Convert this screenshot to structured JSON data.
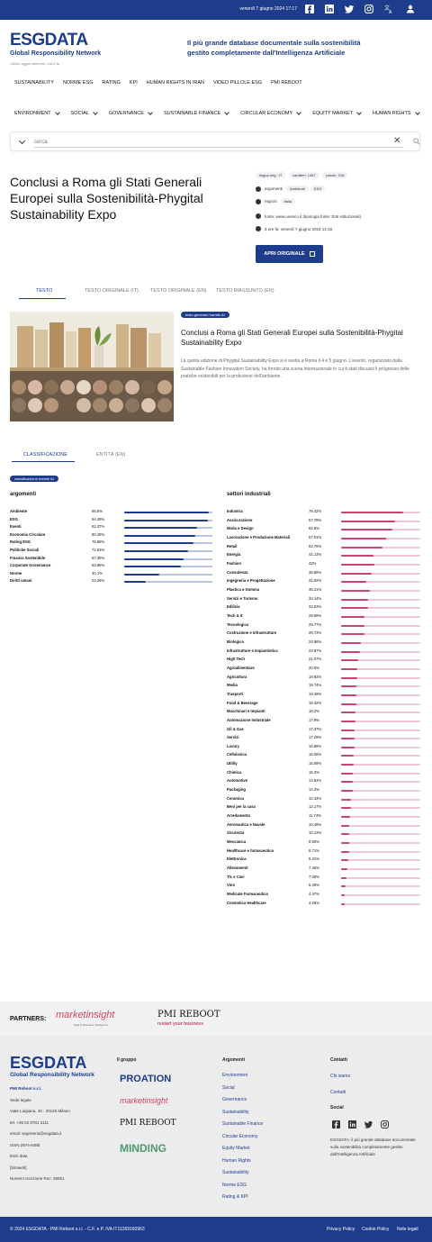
{
  "topbar": {
    "date": "venerdì 7 giugno 2024 17:17",
    "bg": "#1d3c8c"
  },
  "brand": {
    "logo": "ESGDATA",
    "logo_sub": "Global Responsibility Network",
    "update": "Ultimo aggiornamento: ora e fa",
    "tagline_1": "Il più grande database documentale sulla sostenibilità",
    "tagline_2": "gestito completamente dall'Intelligenza Artificiale"
  },
  "nav_primary": [
    "SUSTAINABILITY",
    "NORME ESG",
    "RATING",
    "KPI",
    "HUMAN RIGHTS IN IRAN",
    "VIDEO PILLOLE ESG",
    "PMI REBOOT"
  ],
  "nav_secondary": [
    "ENVIRONMENT",
    "SOCIAL",
    "GOVERNANCE",
    "SUSTAINABLE FINANCE",
    "CIRCULAR ECONOMY",
    "EQUITY MARKET",
    "HUMAN RIGHTS"
  ],
  "search": {
    "placeholder": "cerca"
  },
  "article": {
    "title": "Conclusi a Roma gli Stati Generali Europei sulla Sostenibilità-Phygital Sustainability Expo",
    "chips": [
      "lingua orig.: IT",
      "caratteri: 1487",
      "parole: 218"
    ],
    "argomenti_label": "argomenti",
    "argomenti": [
      "Ambiente",
      "ESG"
    ],
    "regioni_label": "regioni",
    "regioni": [
      "Italia"
    ],
    "fonte": "fonte: www.unesco.it (tipologia fonte: Enti istituzionali)",
    "time": "3 ore fa: venerdì 7 giugno 2024 14:18",
    "open_button": "APRI ORIGINALE"
  },
  "tabs": [
    "TESTO",
    "TESTO ORIGINALE (IT)",
    "TESTO ORIGINALE (EN)",
    "TESTO RIASSUNTO (EN)"
  ],
  "content": {
    "ai_badge": "testo generato tramite AI",
    "title": "Conclusi a Roma gli Stati Generali Europei sulla Sostenibilità-Phygital Sustainability Expo",
    "body": "La quinta edizione di Phygital Sustainability Expo si è svolta a Roma il 4 e 5 giugno. L'evento, organizzato dalla Sustainable Fashion Innovation Society, ha fornito una scena internazionale in cui è stati discussi il progresso delle pratiche sostenibili per la protezione dell'ambiente."
  },
  "tabs2": [
    "CLASSIFICAZIONE",
    "ENTITÀ (EN)"
  ],
  "classification": {
    "ai_badge": "classificazione tramite AI",
    "argomenti_title": "argomenti",
    "argomenti": [
      {
        "label": "Ambiente",
        "value": 95.8,
        "text": "95.8%"
      },
      {
        "label": "ESG",
        "value": 94.49,
        "text": "94.49%"
      },
      {
        "label": "Eventi",
        "value": 82.37,
        "text": "82.37%"
      },
      {
        "label": "Economia Circolare",
        "value": 80.28,
        "text": "80.28%"
      },
      {
        "label": "Rating ESG",
        "value": 78.86,
        "text": "78.86%"
      },
      {
        "label": "Politiche Sociali",
        "value": 72.63,
        "text": "72.63%"
      },
      {
        "label": "Finanza Sostenibile",
        "value": 67.35,
        "text": "67.35%"
      },
      {
        "label": "Corporate Governance",
        "value": 63.95,
        "text": "63.95%"
      },
      {
        "label": "Norme",
        "value": 40.1,
        "text": "40.1%"
      },
      {
        "label": "Diritti umani",
        "value": 24.26,
        "text": "24.26%"
      }
    ],
    "settori_title": "settori industriali",
    "settori": [
      {
        "label": "Industria",
        "value": 78.42,
        "text": "78.42%"
      },
      {
        "label": "Assicurazione",
        "value": 67.78,
        "text": "67.78%"
      },
      {
        "label": "Moda e Design",
        "value": 64.5,
        "text": "64.5%"
      },
      {
        "label": "Lavorazione e Produzione Materiali",
        "value": 57.01,
        "text": "57.01%"
      },
      {
        "label": "Retail",
        "value": 52.76,
        "text": "52.76%"
      },
      {
        "label": "Energia",
        "value": 41.13,
        "text": "41.13%"
      },
      {
        "label": "Fashion",
        "value": 42,
        "text": "42%"
      },
      {
        "label": "Consulenza",
        "value": 38.65,
        "text": "38.65%"
      },
      {
        "label": "Ingegneria e Progettazione",
        "value": 31.82,
        "text": "31.82%"
      },
      {
        "label": "Plastica e Gomma",
        "value": 36.21,
        "text": "36.21%"
      },
      {
        "label": "Servizi e Turismo",
        "value": 34.14,
        "text": "34.14%"
      },
      {
        "label": "Edilizia",
        "value": 33.53,
        "text": "33.53%"
      },
      {
        "label": "Tech & It",
        "value": 29.69,
        "text": "29.69%"
      },
      {
        "label": "Tecnologico",
        "value": 29.77,
        "text": "29.77%"
      },
      {
        "label": "Costruzione e Infrastrutture",
        "value": 29.73,
        "text": "29.73%"
      },
      {
        "label": "Biologico",
        "value": 24.96,
        "text": "24.96%"
      },
      {
        "label": "Infrastrutture e Impiantistica",
        "value": 23.97,
        "text": "23.97%"
      },
      {
        "label": "High Tech",
        "value": 21.07,
        "text": "21.07%"
      },
      {
        "label": "Agroalimentare",
        "value": 20.9,
        "text": "20.9%"
      },
      {
        "label": "Agricoltura",
        "value": 19.92,
        "text": "19.92%"
      },
      {
        "label": "Media",
        "value": 19.74,
        "text": "19.74%"
      },
      {
        "label": "Trasporti",
        "value": 19.49,
        "text": "19.49%"
      },
      {
        "label": "Food & Beverage",
        "value": 19.42,
        "text": "19.42%"
      },
      {
        "label": "Macchinari e Impianti",
        "value": 18.2,
        "text": "18.2%"
      },
      {
        "label": "Automazione Industriale",
        "value": 17.9,
        "text": "17.9%"
      },
      {
        "label": "Oil & Gas",
        "value": 17.37,
        "text": "17.37%"
      },
      {
        "label": "Servizi",
        "value": 17.29,
        "text": "17.29%"
      },
      {
        "label": "Luxury",
        "value": 16.89,
        "text": "16.89%"
      },
      {
        "label": "Cellulosica",
        "value": 16.06,
        "text": "16.06%"
      },
      {
        "label": "Utility",
        "value": 15.69,
        "text": "15.69%"
      },
      {
        "label": "Chimica",
        "value": 15.3,
        "text": "15.3%"
      },
      {
        "label": "Automotive",
        "value": 14.54,
        "text": "14.54%"
      },
      {
        "label": "Packaging",
        "value": 14.3,
        "text": "14.3%"
      },
      {
        "label": "Ceramica",
        "value": 12.34,
        "text": "12.34%"
      },
      {
        "label": "Beni per la casa",
        "value": 12.17,
        "text": "12.17%"
      },
      {
        "label": "Arredamento",
        "value": 11.74,
        "text": "11.74%"
      },
      {
        "label": "Aeronautica e Navale",
        "value": 10.48,
        "text": "10.48%"
      },
      {
        "label": "Sicurezza",
        "value": 10.13,
        "text": "10.13%"
      },
      {
        "label": "Meccanica",
        "value": 9.93,
        "text": "9.93%"
      },
      {
        "label": "Healthcare e farmaceutico",
        "value": 9.71,
        "text": "9.71%"
      },
      {
        "label": "Elettronica",
        "value": 9.31,
        "text": "9.31%"
      },
      {
        "label": "Allevamenti",
        "value": 7.46,
        "text": "7.46%"
      },
      {
        "label": "Tlc e Cavi",
        "value": 7.06,
        "text": "7.06%"
      },
      {
        "label": "Vino",
        "value": 5.46,
        "text": "5.46%"
      },
      {
        "label": "Medicale Farmaceutico",
        "value": 4.47,
        "text": "4.47%"
      },
      {
        "label": "Cosmetica Healthcare",
        "value": 4.25,
        "text": "4.25%"
      }
    ],
    "colors": {
      "argomenti": "#1d3c8c",
      "settori": "#c9466a",
      "track_arg": "#b9c4e4",
      "track_set": "#f3c7d3"
    }
  },
  "partners": {
    "label": "PARTNERS:",
    "p1": "marketinsight",
    "p1_sub": "Data & Business Intelligence",
    "p2": "PMI REBOOT",
    "p2_sub": "restart your business"
  },
  "footer": {
    "logo": "ESGDATA",
    "logo_sub": "Global Responsibility Network",
    "company": "PMI Reboot s.r.l.",
    "sede_label": "Sede legale",
    "address": "Viale Luigiana, 40 - 20125 Milano",
    "tel": "tel. +39 02 8781 3111",
    "email": "email: segreteria@esgdata.it",
    "issn": "ISSN 2974-6485",
    "esg_data": "ESG data",
    "sitoweb": "[Sitoweb]",
    "iscrizione": "Numero Iscrizione Roc: 39051",
    "gruppo_title": "Il gruppo",
    "gruppo": [
      "PROATION",
      "marketinsight",
      "PMI REBOOT",
      "MINDING"
    ],
    "argomenti_title": "Argomenti",
    "argomenti": [
      "Environment",
      "Social",
      "Governance",
      "Sustainability",
      "Sustainable Finance",
      "Circular Economy",
      "Equity Market",
      "Human Rights",
      "Sustainability",
      "Norme ESG",
      "Rating & KPI"
    ],
    "contatti_title": "Contatti",
    "contatti": [
      "Chi siamo",
      "Contatti"
    ],
    "social_title": "Social",
    "about": "ESGDATA: il più grande database documentale sulla sostenibilità completamente gestito dall'Intelligenza Artificiale"
  },
  "bottombar": {
    "copyright": "© 2024 ESGDATA - PMI Reboot s.r.l. - C.F. e P. IVA IT11269160963",
    "links": [
      "Privacy Policy",
      "Cookie Policy",
      "Note legali"
    ]
  }
}
